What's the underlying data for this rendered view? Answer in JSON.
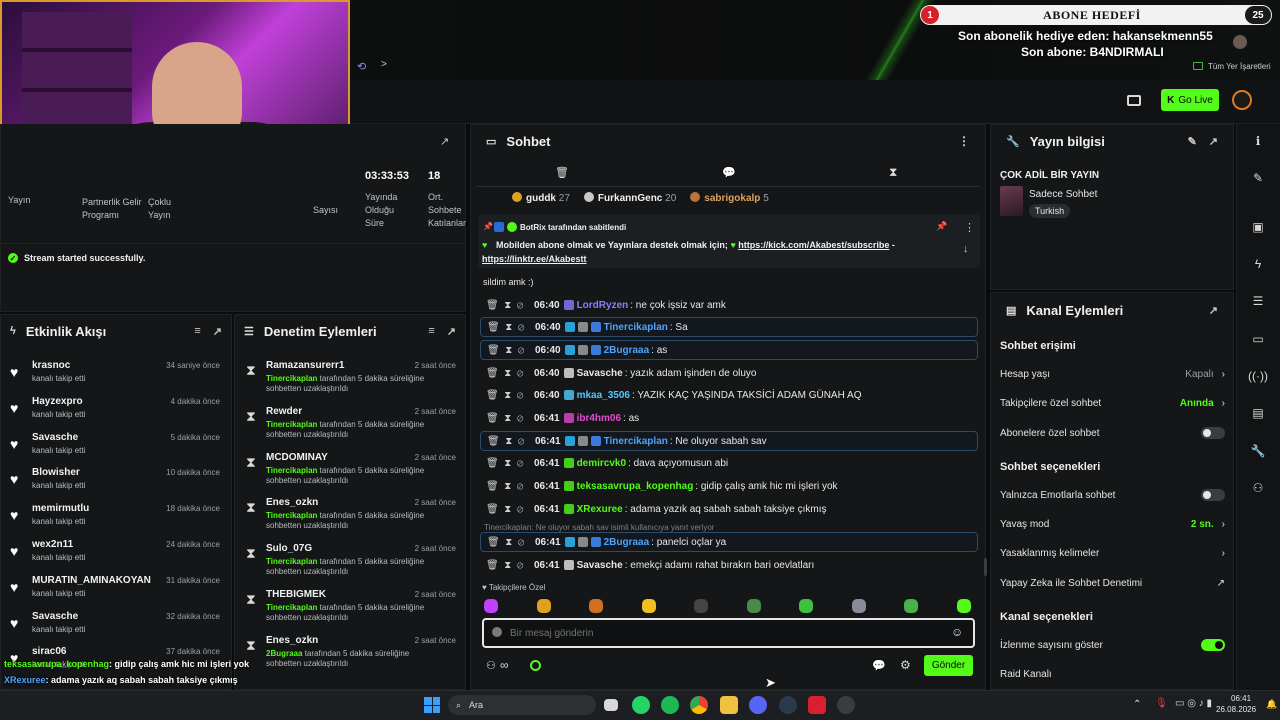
{
  "overlay": {
    "goal_title": "ABONE HEDEFİ",
    "goal_left_num": "1",
    "goal_right_num": "25",
    "last_gift": "Son abonelik hediye eden: hakansekmenn55",
    "last_sub": "Son abone: B4NDIRMALI"
  },
  "browser": {
    "bookmarks_label": "Tüm Yer İşaretleri"
  },
  "header": {
    "go_live": "Go Live"
  },
  "stats": {
    "duration": "03:33:53",
    "count": "18",
    "labels": [
      "Partnerlik Gelir Programı",
      "Çoklu Yayın",
      "Yayında Olduğu Süre",
      "Ort. Sohbete Katılanlar"
    ],
    "partial_label_1": "Yayın",
    "partial_label_2": "Sayısı"
  },
  "status_msg": "Stream started successfully.",
  "activity": {
    "title": "Etkinlik Akışı",
    "items": [
      {
        "name": "krasnoc",
        "time": "34 saniye önce",
        "sub": "kanalı takip etti"
      },
      {
        "name": "Hayzexpro",
        "time": "4 dakika önce",
        "sub": "kanalı takip etti"
      },
      {
        "name": "Savasche",
        "time": "5 dakika önce",
        "sub": "kanalı takip etti"
      },
      {
        "name": "Blowisher",
        "time": "10 dakika önce",
        "sub": "kanalı takip etti"
      },
      {
        "name": "memirmutlu",
        "time": "18 dakika önce",
        "sub": "kanalı takip etti"
      },
      {
        "name": "wex2n11",
        "time": "24 dakika önce",
        "sub": "kanalı takip etti"
      },
      {
        "name": "MURATIN_AMINAKOYAN",
        "time": "31 dakika önce",
        "sub": "kanalı takip etti"
      },
      {
        "name": "Savasche",
        "time": "32 dakika önce",
        "sub": "kanalı takip etti"
      },
      {
        "name": "sirac06",
        "time": "37 dakika önce",
        "sub": "kanalı takip etti"
      }
    ]
  },
  "moderation": {
    "title": "Denetim Eylemleri",
    "items": [
      {
        "name": "Ramazansurerr1",
        "time": "2 saat önce",
        "actor": "Tinercikaplan",
        "desc": "tarafından 5 dakika süreliğine sohbetten uzaklaştırıldı"
      },
      {
        "name": "Rewder",
        "time": "2 saat önce",
        "actor": "Tinercikaplan",
        "desc": "tarafından 5 dakika süreliğine sohbetten uzaklaştırıldı"
      },
      {
        "name": "MCDOMINAY",
        "time": "2 saat önce",
        "actor": "Tinercikaplan",
        "desc": "tarafından 5 dakika süreliğine sohbetten uzaklaştırıldı"
      },
      {
        "name": "Enes_ozkn",
        "time": "2 saat önce",
        "actor": "Tinercikaplan",
        "desc": "tarafından 5 dakika süreliğine sohbetten uzaklaştırıldı"
      },
      {
        "name": "Sulo_07G",
        "time": "2 saat önce",
        "actor": "Tinercikaplan",
        "desc": "tarafından 5 dakika süreliğine sohbetten uzaklaştırıldı"
      },
      {
        "name": "THEBIGMEK",
        "time": "2 saat önce",
        "actor": "Tinercikaplan",
        "desc": "tarafından 5 dakika süreliğine sohbetten uzaklaştırıldı"
      },
      {
        "name": "Enes_ozkn",
        "time": "2 saat önce",
        "actor": "2Bugraaa",
        "desc": "tarafından 5 dakika süreliğine sohbetten uzaklaştırıldı"
      }
    ]
  },
  "chat": {
    "title": "Sohbet",
    "top_users": [
      {
        "name": "guddk",
        "count": "27"
      },
      {
        "name": "FurkannGenc",
        "count": "20"
      },
      {
        "name": "sabrigokalp",
        "count": "5"
      }
    ],
    "pinned_by": "BotRix tarafından sabitlendi",
    "pinned_text": "Mobilden abone olmak ve Yayınlara destek olmak için;",
    "pinned_link1": "https://kick.com/Akabest/subscribe",
    "pinned_link2": "https://linktr.ee/Akabestt",
    "partial_line": "sildim amk :)",
    "messages": [
      {
        "time": "06:40",
        "user": "LordRyzen",
        "color": "#8a7dff",
        "text": ": ne çok işsiz var amk",
        "hl": false
      },
      {
        "time": "06:40",
        "user": "Tinercikaplan",
        "color": "#4da3ff",
        "text": ": Sa",
        "hl": true
      },
      {
        "time": "06:40",
        "user": "2Bugraaa",
        "color": "#4da3ff",
        "text": ": as",
        "hl": true
      },
      {
        "time": "06:40",
        "user": "Savasche",
        "color": "#e8e8e8",
        "text": ": yazık adam işinden de oluyo",
        "hl": false
      },
      {
        "time": "06:40",
        "user": "mkaa_3506",
        "color": "#53c8ff",
        "text": ": YAZIK KAÇ YAŞINDA TAKSİCİ ADAM GÜNAH AQ",
        "hl": false
      },
      {
        "time": "06:41",
        "user": "ibr4hm06",
        "color": "#e04ad0",
        "text": ": as",
        "hl": false
      },
      {
        "time": "06:41",
        "user": "Tinercikaplan",
        "color": "#4da3ff",
        "text": ": Ne oluyor sabah sav",
        "hl": true
      },
      {
        "time": "06:41",
        "user": "demircvk0",
        "color": "#53fc18",
        "text": ": dava açıyomusun abi",
        "hl": false
      },
      {
        "time": "06:41",
        "user": "teksasavrupa_kopenhag",
        "color": "#53fc18",
        "text": ": gidip çalış amk hic mi işleri yok",
        "hl": false
      },
      {
        "time": "06:41",
        "user": "XRexuree",
        "color": "#53fc18",
        "text": ": adama yazık aq sabah sabah taksiye çıkmış",
        "hl": false
      },
      {
        "time": "06:41",
        "user": "2Bugraaa",
        "color": "#4da3ff",
        "text": ": panelci oçlar ya",
        "hl": true
      },
      {
        "time": "06:41",
        "user": "Savasche",
        "color": "#e8e8e8",
        "text": ": emekçi adamı rahat bırakın bari oevlatları",
        "hl": false
      }
    ],
    "reply_hint": "Tinercikaplan: Ne oluyor sabah sav isimli kullanıcıya yanıt veriyor",
    "followers_label": "Takipçilere Özel",
    "input_placeholder": "Bir mesaj gönderin",
    "send_label": "Gönder"
  },
  "stream_info": {
    "title": "Yayın bilgisi",
    "stream_title": "ÇOK ADİL BİR YAYIN",
    "category": "Sadece Sohbet",
    "language": "Turkish"
  },
  "channel_actions": {
    "title": "Kanal Eylemleri",
    "chat_access": "Sohbet erişimi",
    "account_age": "Hesap yaşı",
    "account_age_value": "Kapalı",
    "followers_only": "Takipçilere özel sohbet",
    "followers_only_value": "Anında",
    "subs_only": "Abonelere özel sohbet",
    "chat_options": "Sohbet seçenekleri",
    "emote_only": "Yalnızca Emotlarla sohbet",
    "slow_mode": "Yavaş mod",
    "slow_mode_value": "2 sn.",
    "banned_words": "Yasaklanmış kelimeler",
    "ai_moderation": "Yapay Zeka ile Sohbet Denetimi",
    "channel_options": "Kanal seçenekleri",
    "show_viewers": "İzlenme sayısını göster",
    "raid_channel": "Raid Kanalı"
  },
  "overlay_chat": [
    {
      "user": "teksasavrupa_kopenhag",
      "text": ": gidip çalış amk hic mi işleri yok",
      "color": "#53fc18"
    },
    {
      "user": "XRexuree",
      "text": ": adama yazık aq sabah sabah taksiye çıkmış",
      "color": "#4da3ff"
    },
    {
      "user": "2Bugraaa",
      "text": ": panelci oçlar ya",
      "color": "#b06aff"
    },
    {
      "user": "Savasche",
      "text": ": emekçi adamı rahat bırakın bari oevlatları",
      "color": "#ffffff"
    }
  ],
  "taskbar": {
    "search": "Ara",
    "time": "06:41",
    "date": "26.08.2026"
  },
  "colors": {
    "accent": "#53fc18",
    "panel": "#141617",
    "highlight_border": "#2c4a6a"
  }
}
